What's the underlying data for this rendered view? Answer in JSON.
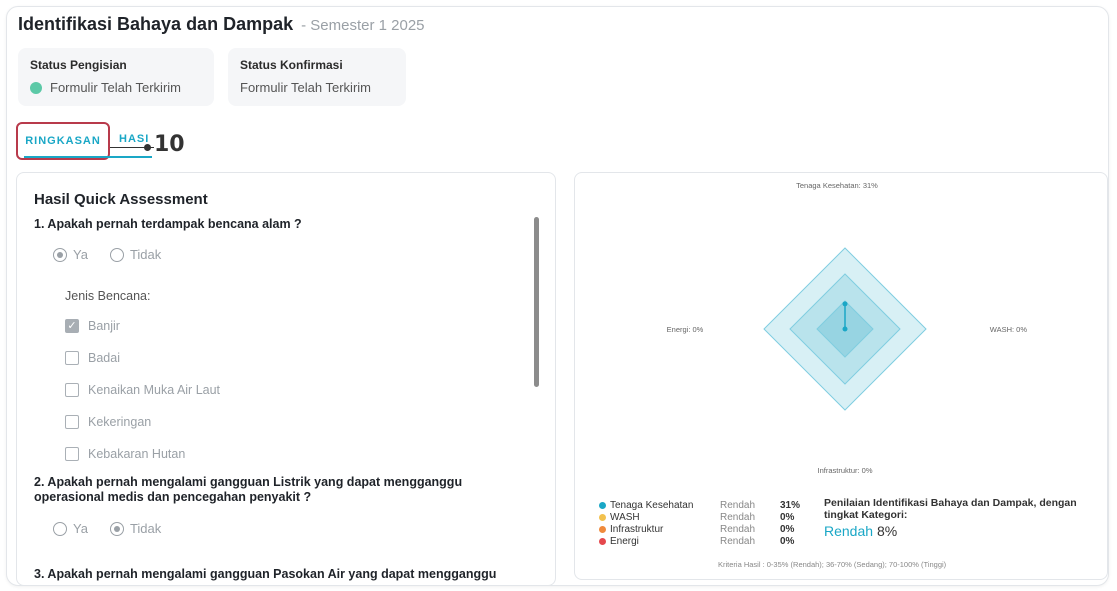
{
  "header": {
    "title": "Identifikasi Bahaya dan Dampak",
    "subtitle": "- Semester 1 2025"
  },
  "status": {
    "pengisian": {
      "label": "Status Pengisian",
      "value": "Formulir Telah Terkirim",
      "dot_color": "#5cc9a7"
    },
    "konfirmasi": {
      "label": "Status Konfirmasi",
      "value": "Formulir Telah Terkirim"
    }
  },
  "tabs": {
    "ringkasan": "RINGKASAN",
    "hasil": "HASI",
    "callout": "10"
  },
  "assessment": {
    "title": "Hasil Quick Assessment",
    "q1": {
      "text": "1. Apakah pernah terdampak bencana alam ?",
      "options": [
        "Ya",
        "Tidak"
      ],
      "selected": "Ya",
      "jenis_label": "Jenis Bencana:",
      "disasters": [
        {
          "label": "Banjir",
          "checked": true
        },
        {
          "label": "Badai",
          "checked": false
        },
        {
          "label": "Kenaikan Muka Air Laut",
          "checked": false
        },
        {
          "label": "Kekeringan",
          "checked": false
        },
        {
          "label": "Kebakaran Hutan",
          "checked": false
        }
      ]
    },
    "q2": {
      "text": "2. Apakah pernah mengalami gangguan Listrik yang dapat mengganggu operasional medis dan pencegahan penyakit ?",
      "options": [
        "Ya",
        "Tidak"
      ],
      "selected": "Tidak"
    },
    "q3": {
      "text": "3. Apakah pernah mengalami gangguan Pasokan Air yang dapat mengganggu"
    }
  },
  "radar": {
    "labels": {
      "top": "Tenaga Kesehatan: 31%",
      "right": "WASH: 0%",
      "bottom": "Infrastruktur: 0%",
      "left": "Energi: 0%"
    },
    "values": {
      "tenaga_kesehatan": 31,
      "wash": 0,
      "infrastruktur": 0,
      "energi": 0
    },
    "max": 100
  },
  "legend": [
    {
      "name": "Tenaga Kesehatan",
      "category": "Rendah",
      "pct": "31%",
      "color": "#1aa7c6"
    },
    {
      "name": "WASH",
      "category": "Rendah",
      "pct": "0%",
      "color": "#f2c14e"
    },
    {
      "name": "Infrastruktur",
      "category": "Rendah",
      "pct": "0%",
      "color": "#f08a3c"
    },
    {
      "name": "Energi",
      "category": "Rendah",
      "pct": "0%",
      "color": "#e5484d"
    }
  ],
  "summary": {
    "text": "Penilaian Identifikasi Bahaya dan Dampak, dengan tingkat Kategori:",
    "category": "Rendah",
    "percent": "8%",
    "criteria": "Kriteria Hasil : 0-35% (Rendah); 36-70% (Sedang); 70-100% (Tinggi)"
  },
  "colors": {
    "accent": "#1aa7c6",
    "tab_border": "#b83a4b"
  }
}
